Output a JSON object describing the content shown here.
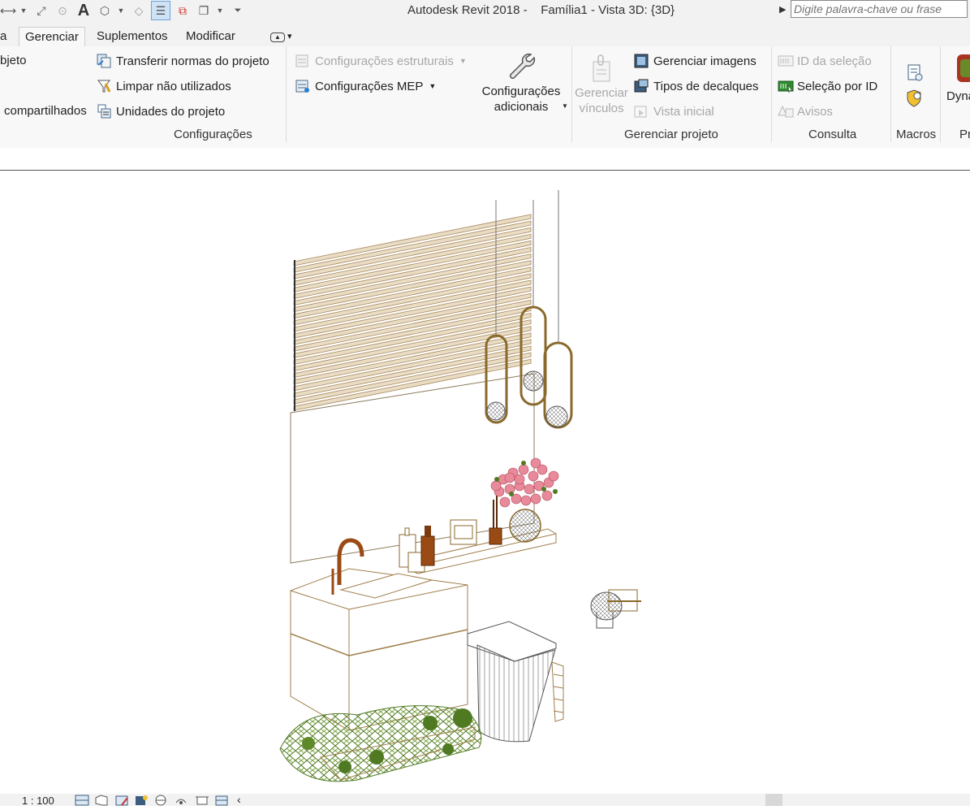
{
  "title": {
    "app": "Autodesk Revit 2018 -",
    "document": "Família1 - Vista 3D: {3D}"
  },
  "search": {
    "placeholder": "Digite palavra-chave ou frase"
  },
  "tabs": [
    {
      "label": "a"
    },
    {
      "label": "Gerenciar"
    },
    {
      "label": "Suplementos"
    },
    {
      "label": "Modificar"
    }
  ],
  "ribbon": {
    "col1": {
      "item1": "bjeto",
      "item2": "compartilhados"
    },
    "settings": {
      "transfer": "Transferir normas do projeto",
      "purge": "Limpar não utilizados",
      "units": "Unidades do projeto",
      "structural": "Configurações estruturais",
      "mep": "Configurações MEP",
      "additional_line1": "Configurações",
      "additional_line2": "adicionais",
      "panel": "Configurações"
    },
    "manage_project": {
      "links_line1": "Gerenciar",
      "links_line2": "vínculos",
      "images": "Gerenciar imagens",
      "decals": "Tipos de decalques",
      "starting_view": "Vista inicial",
      "panel": "Gerenciar projeto"
    },
    "inquiry": {
      "selection_ids": "ID da seleção",
      "select_by_id": "Seleção por ID",
      "warnings": "Avisos",
      "panel": "Consulta"
    },
    "macros": {
      "panel": "Macros"
    },
    "dynamo": {
      "label": "Dyna",
      "panel": "Pr"
    }
  },
  "status": {
    "scale": "1 : 100"
  },
  "colors": {
    "wood": "#a8875a",
    "brass": "#8a6a2c",
    "copper": "#9a4a14",
    "flowers": "#e88a9a",
    "leaves": "#4f7a22",
    "line": "#a07f4c"
  }
}
